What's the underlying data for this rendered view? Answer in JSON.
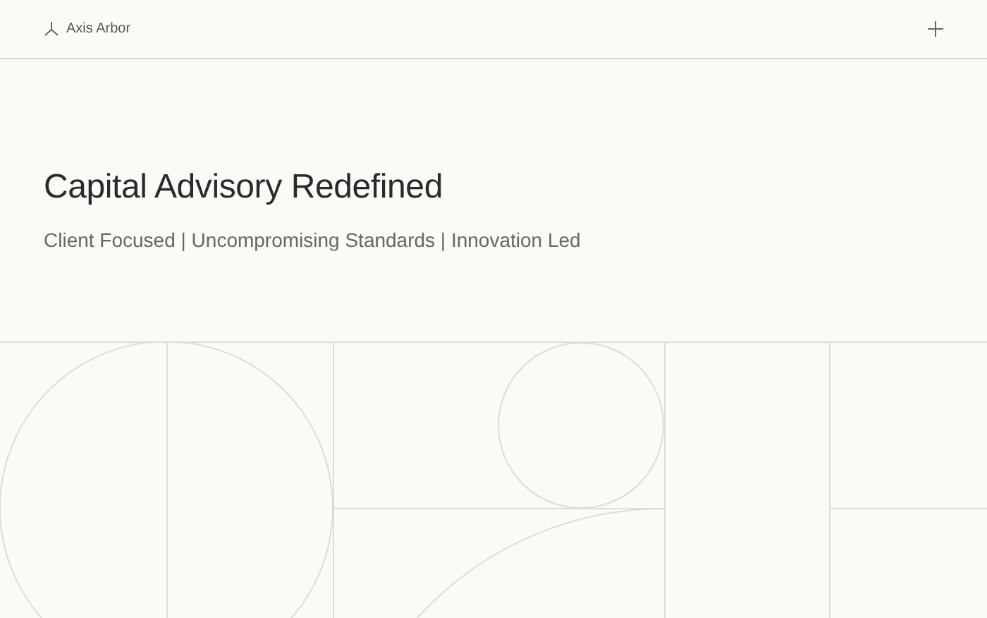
{
  "header": {
    "brand": "Axis Arbor"
  },
  "hero": {
    "title": "Capital Advisory Redefined",
    "subtitle": "Client Focused | Uncompromising Standards | Innovation Led"
  }
}
